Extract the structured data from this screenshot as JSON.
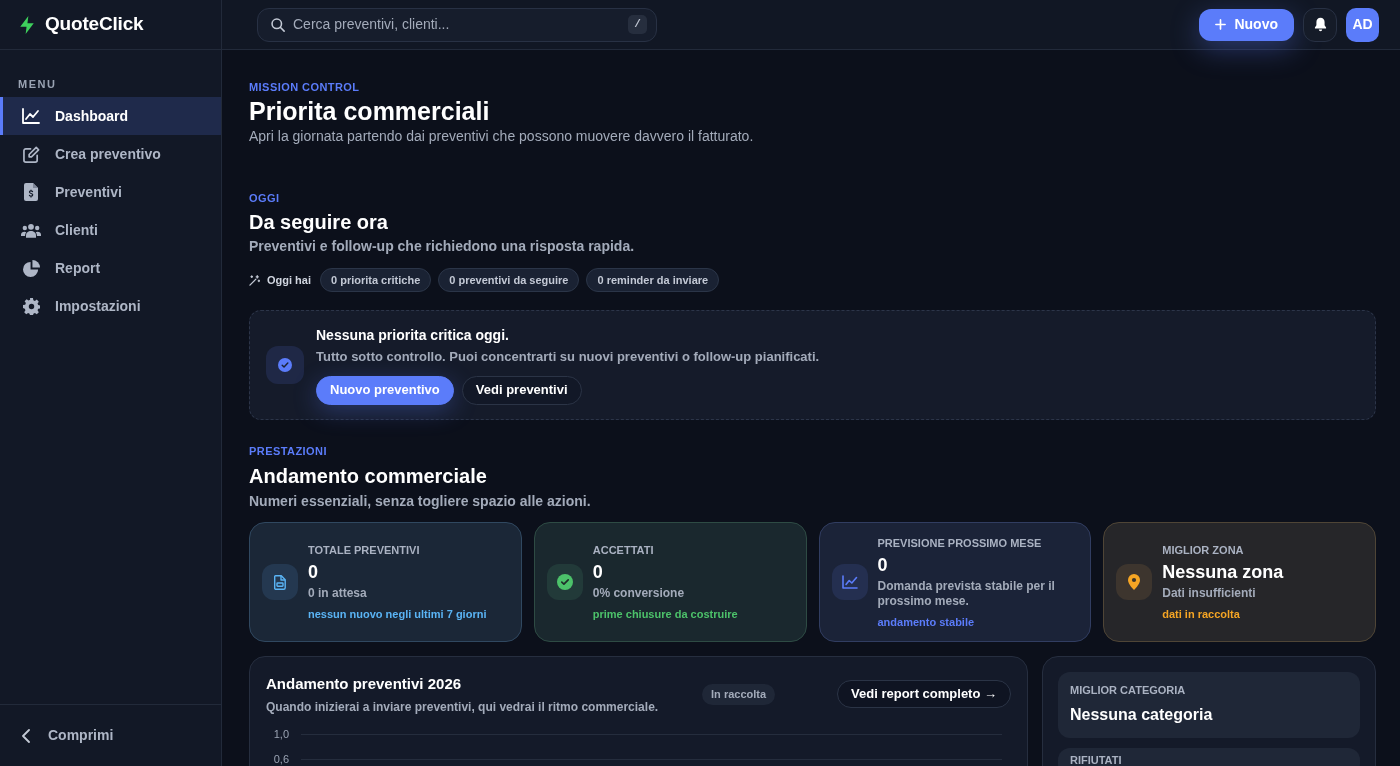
{
  "app": {
    "name": "QuoteClick"
  },
  "search": {
    "placeholder": "Cerca preventivi, clienti...",
    "shortcut": "/"
  },
  "topbar": {
    "new_button": "Nuovo",
    "avatar": "AD"
  },
  "sidebar": {
    "heading": "MENU",
    "items": [
      {
        "label": "Dashboard",
        "selected": true
      },
      {
        "label": "Crea preventivo",
        "selected": false
      },
      {
        "label": "Preventivi",
        "selected": false
      },
      {
        "label": "Clienti",
        "selected": false
      },
      {
        "label": "Report",
        "selected": false
      },
      {
        "label": "Impostazioni",
        "selected": false
      }
    ],
    "collapse": "Comprimi"
  },
  "header": {
    "eyebrow": "MISSION CONTROL",
    "title": "Priorita commerciali",
    "subtitle": "Apri la giornata partendo dai preventivi che possono muovere davvero il fatturato."
  },
  "today": {
    "eyebrow": "OGGI",
    "title": "Da seguire ora",
    "subtitle": "Preventivi e follow-up che richiedono una risposta rapida.",
    "summary_label": "Oggi hai",
    "chips": [
      "0 priorita critiche",
      "0 preventivi da seguire",
      "0 reminder da inviare"
    ]
  },
  "alert": {
    "title": "Nessuna priorita critica oggi.",
    "text": "Tutto sotto controllo. Puoi concentrarti su nuovi preventivi o follow-up pianificati.",
    "buttons": [
      {
        "label": "Nuovo preventivo",
        "kind": "primary"
      },
      {
        "label": "Vedi preventivi",
        "kind": "secondary"
      }
    ]
  },
  "performance": {
    "eyebrow": "PRESTAZIONI",
    "title": "Andamento commerciale",
    "subtitle": "Numeri essenziali, senza togliere spazio alle azioni.",
    "cards": [
      {
        "label": "TOTALE PREVENTIVI",
        "value": "0",
        "detail": "0 in attesa",
        "note": "nessun nuovo negli ultimi 7 giorni",
        "color": "#5ab4f5"
      },
      {
        "label": "ACCETTATI",
        "value": "0",
        "detail": "0% conversione",
        "note": "prime chiusure da costruire",
        "color": "#4cc26a"
      },
      {
        "label": "PREVISIONE PROSSIMO MESE",
        "value": "0",
        "detail": "Domanda prevista stabile per il prossimo mese.",
        "note": "andamento stabile",
        "color": "#5b7cfa"
      },
      {
        "label": "MIGLIOR ZONA",
        "value": "Nessuna zona",
        "detail": "Dati insufficienti",
        "note": "dati in raccolta",
        "color": "#f5a524"
      }
    ]
  },
  "trend_panel": {
    "title": "Andamento preventivi 2026",
    "subtitle": "Quando inizierai a inviare preventivi, qui vedrai il ritmo commerciale.",
    "badge": "In raccolta",
    "link": "Vedi report completo →",
    "y_axis_labels": [
      "1,0",
      "0,6"
    ]
  },
  "side_panel": {
    "cards": [
      {
        "label": "MIGLIOR CATEGORIA",
        "value": "Nessuna categoria"
      },
      {
        "label": "RIFIUTATI"
      }
    ]
  }
}
